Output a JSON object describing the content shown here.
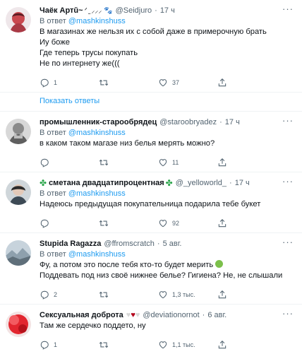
{
  "ui": {
    "reply_prefix": "В ответ",
    "dot": "·",
    "show_replies": "Показать ответы"
  },
  "colors": {
    "link": "#1d9bf0",
    "muted": "#536471",
    "text": "#0f1419"
  },
  "tweets": [
    {
      "name": "Чаёк Артŭ~",
      "name_emoji": "ᐟ ̫ ⸝⸝⸝ 🐾",
      "handle": "@Seidjuro",
      "time": "17 ч",
      "reply_to": "@mashkinshuss",
      "lines": [
        "В магазинах же нельзя их с собой даже в примерочную брать",
        "Иу боже",
        "Где теперь трусы покупать",
        "Не по интернету же((("
      ],
      "replies": "1",
      "retweets": "",
      "likes": "37"
    },
    {
      "name": "промышленник-старообрядец",
      "handle": "@staroobryadez",
      "time": "17 ч",
      "reply_to": "@mashkinshuss",
      "lines": [
        "в каком таком магазе низ белья мерять можно?"
      ],
      "replies": "",
      "retweets": "",
      "likes": "11"
    },
    {
      "name": "сметана двадцатипроцентная",
      "handle": "@_yelloworld_",
      "time": "17 ч",
      "reply_to": "@mashkinshuss",
      "lines": [
        "Надеюсь предыдущая покупательница подарила тебе букет"
      ],
      "replies": "",
      "retweets": "",
      "likes": "92"
    },
    {
      "name": "Stupida Ragazza",
      "handle": "@ffromscratch",
      "time": "5 авг.",
      "reply_to": "@mashkinshuss",
      "lines": [
        "Фу, а потом это после тебя кто-то будет мерить",
        "Поддевать под низ своё нижнее белье? Гигиена? Не, не слышали"
      ],
      "replies": "2",
      "retweets": "",
      "likes": "1,3 тыс."
    },
    {
      "name": "Сексуальная доброта",
      "handle": "@deviationornot",
      "time": "6 авг.",
      "lines": [
        "Там же сердечко поддето, ну"
      ],
      "replies": "1",
      "retweets": "",
      "likes": "1,1 тыс."
    }
  ]
}
